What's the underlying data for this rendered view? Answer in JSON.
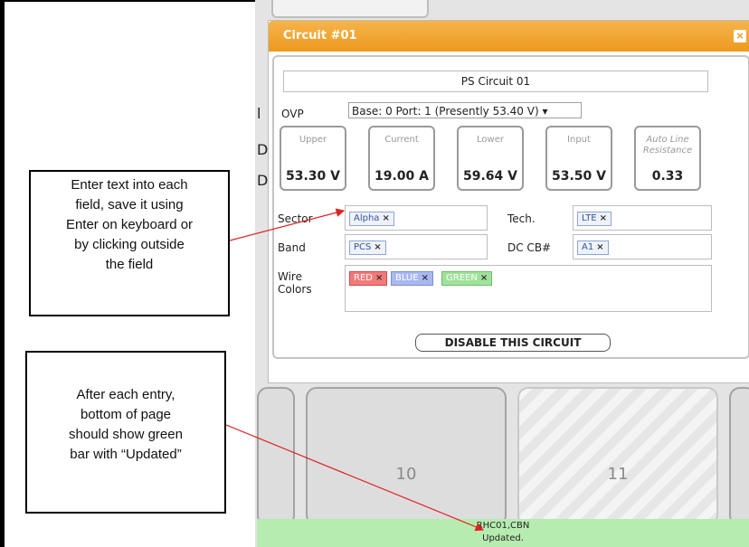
{
  "dialog": {
    "title": "Circuit #01",
    "close_icon": "close-icon",
    "circuit_name": "PS Circuit 01",
    "ovp_label": "OVP",
    "ovp_value": "Base: 0 Port: 1 (Presently 53.40 V) ▾",
    "gauges": [
      {
        "label": "Upper",
        "value": "53.30 V"
      },
      {
        "label": "Current",
        "value": "19.00 A"
      },
      {
        "label": "Lower",
        "value": "59.64 V"
      },
      {
        "label": "Input",
        "value": "53.50 V"
      },
      {
        "label": "Auto Line Resistance",
        "value": "0.33"
      }
    ],
    "fields": {
      "sector_label": "Sector",
      "sector_tag": "Alpha",
      "tech_label": "Tech.",
      "tech_tag": "LTE",
      "band_label": "Band",
      "band_tag": "PCS",
      "dccb_label": "DC CB#",
      "dccb_tag": "A1",
      "wire_label_1": "Wire",
      "wire_label_2": "Colors",
      "wire_tags": [
        "RED",
        "BLUE",
        "GREEN"
      ],
      "tag_remove": "×"
    },
    "disable_button": "DISABLE THIS CIRCUIT"
  },
  "tiles": [
    {
      "number": "10"
    },
    {
      "number": "11"
    }
  ],
  "status": {
    "line1": "RHC01,CBN",
    "line2": "Updated."
  },
  "callouts": {
    "top": [
      "Enter text into each",
      "field, save it using",
      "Enter on keyboard or",
      "by clicking outside",
      "the field"
    ],
    "bottom": [
      "After each entry,",
      "bottom of page",
      "should show green",
      "bar with “Updated”"
    ]
  },
  "colors": {
    "title_bar": "#ec9a1f",
    "status_bar": "#b7ecb0",
    "arrow": "#e02020"
  }
}
